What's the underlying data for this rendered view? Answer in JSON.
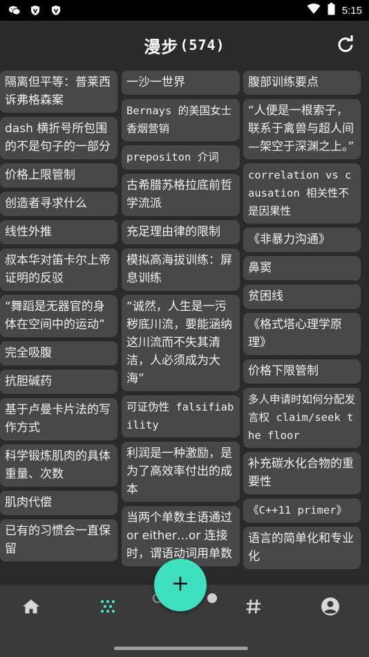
{
  "status_bar": {
    "time": "5:15"
  },
  "header": {
    "title": "漫步",
    "count": "(574)"
  },
  "columns": {
    "col1": [
      "隔离但平等：普莱西诉弗格森案",
      "dash 横折号所包围的不是句子的一部分",
      "价格上限管制",
      "创造者寻求什么",
      "线性外推",
      "叔本华对笛卡尔上帝证明的反驳",
      "“舞蹈是无器官的身体在空间中的运动”",
      "完全吸腹",
      "抗胆碱药",
      "基于卢曼卡片法的写作方式",
      "科学锻炼肌肉的具体重量、次数",
      "肌肉代偿",
      "已有的习惯会一直保留"
    ],
    "col2": [
      "一沙一世界",
      "Bernays 的美国女士香烟营销",
      "prepositon 介词",
      "古希腊苏格拉底前哲学流派",
      "充足理由律的限制",
      "模拟高海拔训练：屏息训练",
      "“诚然，人生是一污秽底川流，要能涵纳这川流而不失其清洁，人必须成为大海”",
      "可证伪性 falsifiability",
      "利润是一种激励，是为了高效率付出的成本",
      "当两个单数主语通过 or either…or 连接时，谓语动词用单数"
    ],
    "col3": [
      "腹部训练要点",
      "“人便是一根索子，联系于禽兽与超人间—架空于深渊之上。”",
      "correlation vs causation 相关性不是因果性",
      "《非暴力沟通》",
      "鼻窦",
      "贫困线",
      "《格式塔心理学原理》",
      "价格下限管制",
      "多人申请时如何分配发言权 claim/seek the floor",
      "补充碳水化合物的重要性",
      "《C++11 primer》",
      "语言的简单化和专业化"
    ]
  },
  "nav": [
    {
      "icon": "home-icon",
      "active": false
    },
    {
      "icon": "scatter-dots-icon",
      "active": true
    },
    {
      "icon": "hashtag-icon",
      "active": false
    },
    {
      "icon": "account-icon",
      "active": false
    }
  ],
  "colors": {
    "accent": "#3ee0c0",
    "card": "#484848",
    "background": "#2b2b2b",
    "nav_background": "#3a3a3a"
  }
}
